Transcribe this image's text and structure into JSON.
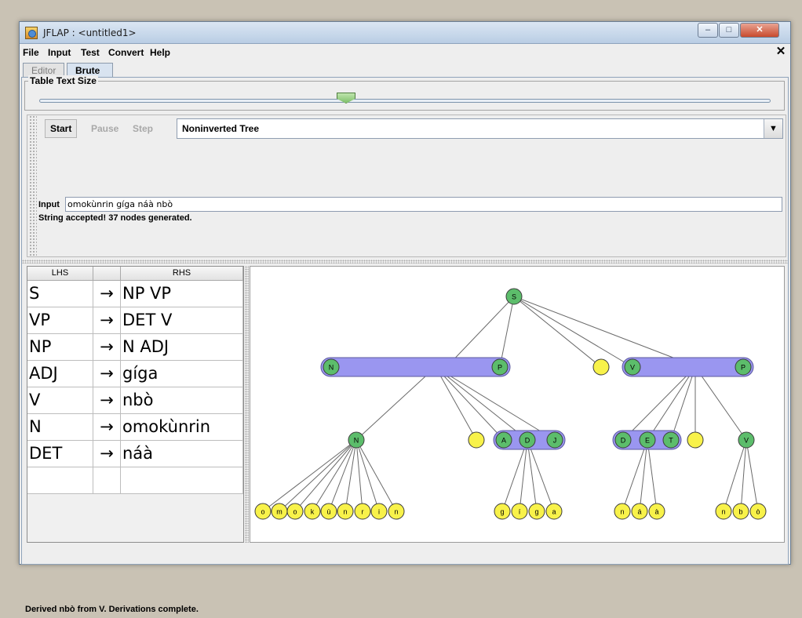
{
  "window": {
    "title": "JFLAP : <untitled1>",
    "minimize_glyph": "–",
    "maximize_glyph": "□",
    "close_glyph": "✕"
  },
  "menu": {
    "items": [
      "File",
      "Input",
      "Test",
      "Convert",
      "Help"
    ],
    "close_glyph": "✕"
  },
  "tabs": [
    {
      "label": "Editor",
      "active": false
    },
    {
      "label": "Brute Parser",
      "active": true
    }
  ],
  "text_size": {
    "legend": "Table Text Size",
    "slider_value_fraction": 0.42
  },
  "toolbar": {
    "start_label": "Start",
    "pause_label": "Pause",
    "step_label": "Step",
    "view_mode": "Noninverted Tree",
    "dropdown_arrow": "▼"
  },
  "input": {
    "label": "Input",
    "value": "omokùnrin gíga náà nbò"
  },
  "result": {
    "message": "String accepted!  37 nodes generated."
  },
  "grammar": {
    "headers": {
      "lhs": "LHS",
      "arrow": "",
      "rhs": "RHS"
    },
    "arrow_glyph": "→",
    "rows": [
      {
        "lhs": "S",
        "rhs": "NP VP"
      },
      {
        "lhs": "VP",
        "rhs": "DET V"
      },
      {
        "lhs": "NP",
        "rhs": "N ADJ"
      },
      {
        "lhs": "ADJ",
        "rhs": "gíga"
      },
      {
        "lhs": "V",
        "rhs": "nbò"
      },
      {
        "lhs": "N",
        "rhs": "omokùnrin"
      },
      {
        "lhs": "DET",
        "rhs": "náà"
      },
      {
        "lhs": "",
        "rhs": ""
      }
    ]
  },
  "tree": {
    "colors": {
      "green": "#5cbd6b",
      "yellow": "#f8f24a",
      "bar": "#9a96f0",
      "edge": "#6a6a6a"
    },
    "root": "S",
    "np_bar": [
      "N",
      "P"
    ],
    "vp_bar": [
      "V",
      "P"
    ],
    "n_node": "N",
    "adj_bar": [
      "A",
      "D",
      "J"
    ],
    "det_bar": [
      "D",
      "E",
      "T"
    ],
    "v_node": "V",
    "leaves": {
      "n": [
        "o",
        "m",
        "o",
        "k",
        "ù",
        "n",
        "r",
        "i",
        "n"
      ],
      "adj": [
        "g",
        "í",
        "g",
        "a"
      ],
      "det": [
        "n",
        "á",
        "à"
      ],
      "v": [
        "n",
        "b",
        "ò"
      ]
    }
  },
  "status": {
    "message": "Derived nbò from V.  Derivations complete."
  }
}
